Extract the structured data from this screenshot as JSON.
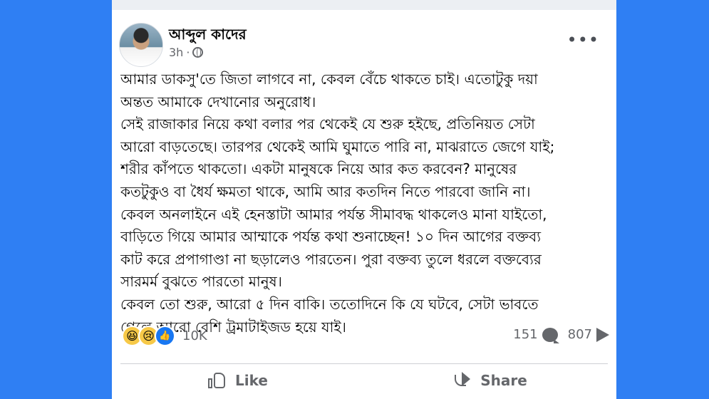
{
  "author": {
    "name": "আব্দুল কাদের",
    "time": "3h"
  },
  "menu_icon": "more-dots-icon",
  "post_lines": [
    "আমার ডাকসু'তে জিতা লাগবে না, কেবল বেঁচে থাকতে চাই। এতোটুকু দয়া",
    "অন্তত আমাকে দেখানোর অনুরোধ।",
    "সেই রাজাকার নিয়ে কথা বলার পর থেকেই যে শুরু হইছে, প্রতিনিয়ত সেটা",
    "আরো বাড়তেছে। তারপর থেকেই আমি ঘুমাতে পারি না, মাঝরাতে জেগে যাই;",
    "শরীর কাঁপতে থাকতো। একটা মানুষকে নিয়ে আর কত করবেন? মানুষের",
    "কতটুকুও বা ধৈর্য ক্ষমতা থাকে, আমি আর কতদিন নিতে পারবো জানি না।",
    "কেবল অনলাইনে এই হেনস্তাটা আমার পর্যন্ত সীমাবদ্ধ থাকলেও মানা যাইতো,",
    "বাড়িতে গিয়ে আমার আম্মাকে পর্যন্ত কথা শুনাচ্ছেন! ১০ দিন আগের বক্তব্য",
    "কাট করে প্রপাগাণ্ডা না ছড়ালেও পারতেন। পুরা বক্তব্য তুলে ধরলে বক্তব্যের",
    "সারমর্ম বুঝতে পারতো মানুষ।",
    "কেবল তো শুরু, আরো ৫ দিন বাকি। ততোদিনে কি যে ঘটবে, সেটা ভাবতে",
    "গেলে আরো বেশি ট্রমাটাইজড হয়ে যাই।"
  ],
  "reactions": {
    "icons": [
      "haha-emoji",
      "sad-emoji",
      "like-emoji"
    ],
    "count": "10K"
  },
  "stats": {
    "comments": "151",
    "shares": "807"
  },
  "actions": {
    "like": "Like",
    "share": "Share"
  }
}
